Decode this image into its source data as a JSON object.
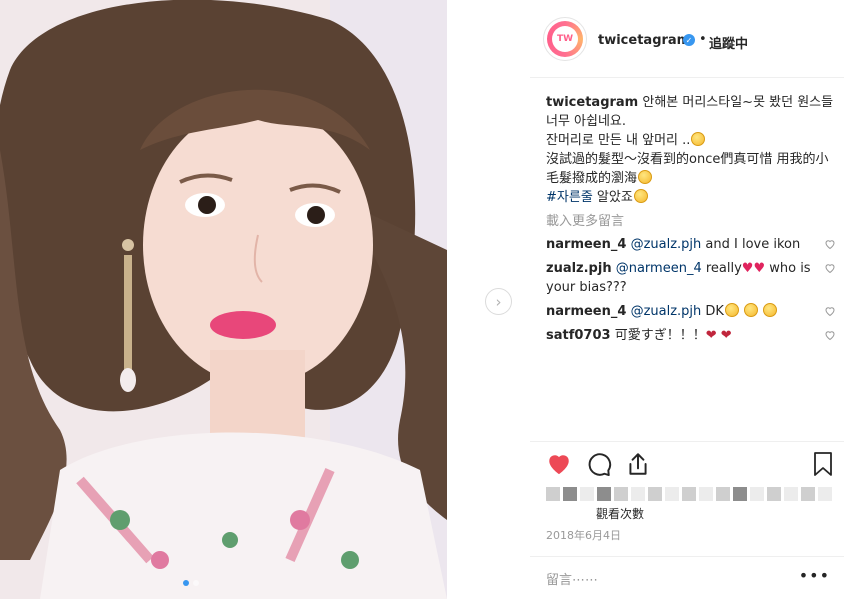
{
  "post": {
    "username": "twicetagram",
    "follow_label": "追蹤中",
    "separator": "•",
    "avatar_text": "TW"
  },
  "caption": {
    "line1": "안해본 머리스타일~못 봤던 원스들 너무 아쉽네요.",
    "line2": "잔머리로 만든 내 앞머리 ..",
    "line3": "沒試過的髮型～沒看到的once們真可惜 用我的小毛髮撥成的瀏海",
    "hashtag": "#자른줄",
    "line4_rest": " 알았죠"
  },
  "load_more": "載入更多留言",
  "comments": [
    {
      "user": "narmeen_4",
      "mention": "@zualz.pjh",
      "text": " and I love ikon"
    },
    {
      "user": "zualz.pjh",
      "mention": "@narmeen_4",
      "text": " really",
      "text2": " who is your bias???"
    },
    {
      "user": "narmeen_4",
      "mention": "@zualz.pjh",
      "text": " DK"
    },
    {
      "user": "satf0703",
      "mention": "",
      "text": " 可愛すぎ！！！"
    }
  ],
  "views_label": "觀看次數",
  "date": "2018年6月4日",
  "add_comment_placeholder": "留言⋯⋯",
  "more_label": "•••",
  "colors": {
    "like_red": "#ed4956",
    "link_blue": "#003569",
    "verified_blue": "#3897f0"
  },
  "icons": [
    "heart-icon",
    "comment-icon",
    "share-icon",
    "bookmark-icon",
    "verified-badge-icon",
    "chevron-right-icon"
  ]
}
